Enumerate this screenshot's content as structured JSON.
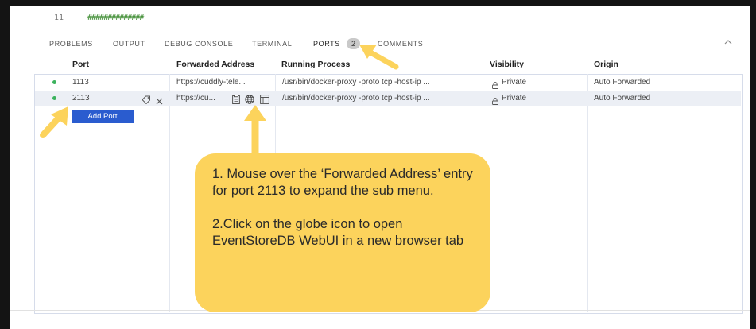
{
  "editor": {
    "line_number": "11",
    "code": "##############"
  },
  "panel": {
    "tabs": [
      {
        "label": "PROBLEMS"
      },
      {
        "label": "OUTPUT"
      },
      {
        "label": "DEBUG CONSOLE"
      },
      {
        "label": "TERMINAL"
      },
      {
        "label": "PORTS",
        "active": true,
        "badge": "2"
      },
      {
        "label": "COMMENTS"
      }
    ],
    "collapse_icon": "chevron-up-icon"
  },
  "ports_table": {
    "headers": [
      "Port",
      "Forwarded Address",
      "Running Process",
      "Visibility",
      "Origin"
    ],
    "rows": [
      {
        "status_color": "#3bb25d",
        "port": "1113",
        "forwarded_address": "https://cuddly-tele...",
        "running_process": "/usr/bin/docker-proxy -proto tcp -host-ip ...",
        "visibility": "Private",
        "origin": "Auto Forwarded"
      },
      {
        "status_color": "#3bb25d",
        "port": "2113",
        "forwarded_address": "https://cu...",
        "running_process": "/usr/bin/docker-proxy -proto tcp -host-ip ...",
        "visibility": "Private",
        "origin": "Auto Forwarded",
        "hovered": true,
        "row_icons": [
          "label-tag-icon",
          "close-icon"
        ],
        "address_icons": [
          "copy-icon",
          "globe-icon",
          "preview-icon"
        ]
      }
    ],
    "add_port_label": "Add Port"
  },
  "callout": {
    "text": "1. Mouse over the ‘Forwarded Address’ entry for port 2113 to expand the sub menu.\n\n2.Click on the globe icon to open EventStoreDB WebUI in a new browser tab",
    "background": "#fcd35c",
    "arrow_color": "#fcd35c"
  },
  "colors": {
    "accent_button": "#2a5ccf",
    "active_tab_underline": "#4f80d8",
    "frame": "#141414"
  }
}
